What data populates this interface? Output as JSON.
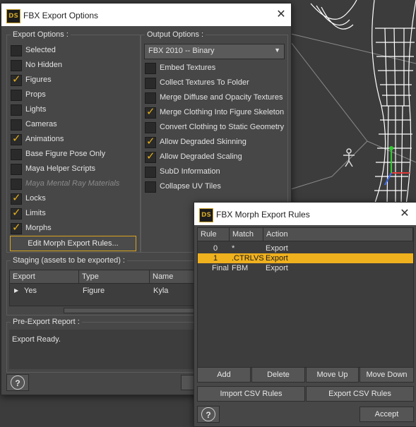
{
  "fbx_window": {
    "title": "FBX Export Options",
    "close": "✕",
    "export_options": {
      "title": "Export Options :",
      "items": [
        {
          "label": "Selected",
          "checked": false,
          "disabled": false
        },
        {
          "label": "No Hidden",
          "checked": false,
          "disabled": false
        },
        {
          "label": "Figures",
          "checked": true,
          "disabled": false
        },
        {
          "label": "Props",
          "checked": false,
          "disabled": false
        },
        {
          "label": "Lights",
          "checked": false,
          "disabled": false
        },
        {
          "label": "Cameras",
          "checked": false,
          "disabled": false
        },
        {
          "label": "Animations",
          "checked": true,
          "disabled": false
        },
        {
          "label": "Base Figure Pose Only",
          "checked": false,
          "disabled": false
        },
        {
          "label": "Maya Helper Scripts",
          "checked": false,
          "disabled": false
        },
        {
          "label": "Maya Mental Ray Materials",
          "checked": false,
          "disabled": true
        },
        {
          "label": "Locks",
          "checked": true,
          "disabled": false
        },
        {
          "label": "Limits",
          "checked": true,
          "disabled": false
        },
        {
          "label": "Morphs",
          "checked": true,
          "disabled": false
        }
      ],
      "edit_morph_button": "Edit Morph Export Rules..."
    },
    "output_options": {
      "title": "Output Options :",
      "format": "FBX 2010 -- Binary",
      "items": [
        {
          "label": "Embed Textures",
          "checked": false
        },
        {
          "label": "Collect Textures To Folder",
          "checked": false
        },
        {
          "label": "Merge Diffuse and Opacity Textures",
          "checked": false
        },
        {
          "label": "Merge Clothing Into Figure Skeleton",
          "checked": true
        },
        {
          "label": "Convert Clothing to Static Geometry",
          "checked": false
        },
        {
          "label": "Allow Degraded Skinning",
          "checked": true
        },
        {
          "label": "Allow Degraded Scaling",
          "checked": true
        },
        {
          "label": "SubD Information",
          "checked": false
        },
        {
          "label": "Collapse UV Tiles",
          "checked": false
        }
      ]
    },
    "staging": {
      "title": "Staging (assets to be exported) :",
      "columns": [
        "Export",
        "Type",
        "Name"
      ],
      "rows": [
        {
          "export": "Yes",
          "type": "Figure",
          "name": "Kyla"
        }
      ]
    },
    "pre_export": {
      "title": "Pre-Export Report :",
      "text": "Export Ready."
    },
    "help": "?"
  },
  "morph_window": {
    "title": "FBX Morph Export Rules",
    "close": "✕",
    "columns": [
      "Rule",
      "Match",
      "Action"
    ],
    "rows": [
      {
        "rule": "0",
        "match": "*",
        "action": "Export",
        "selected": false
      },
      {
        "rule": "1",
        "match": ".CTRLVS",
        "action": "Export",
        "selected": true
      },
      {
        "rule": "Final",
        "match": "FBM",
        "action": "Export",
        "selected": false
      }
    ],
    "buttons": {
      "add": "Add",
      "delete": "Delete",
      "move_up": "Move Up",
      "move_down": "Move Down",
      "import_csv": "Import CSV Rules",
      "export_csv": "Export CSV Rules",
      "accept": "Accept"
    },
    "help": "?"
  },
  "colors": {
    "accent": "#f0b11e",
    "panel": "#474747",
    "viewport": "#3c3c3c",
    "wireframe": "#ffffff"
  },
  "icons": [
    "ds-logo-icon",
    "close-icon",
    "help-icon",
    "check-icon",
    "dropdown-arrow-icon",
    "expand-arrow-icon",
    "figure-widget-icon"
  ]
}
